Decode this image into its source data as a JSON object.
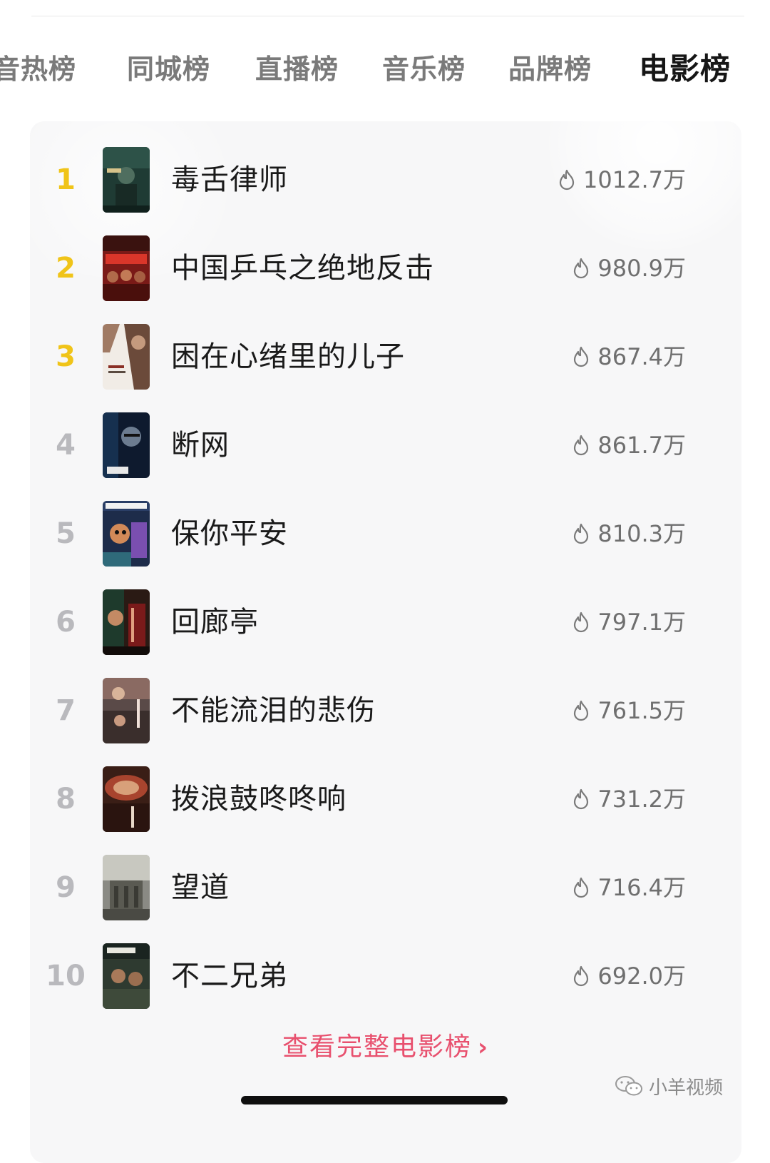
{
  "tabs": [
    {
      "label": "音热榜",
      "active": false
    },
    {
      "label": "同城榜",
      "active": false
    },
    {
      "label": "直播榜",
      "active": false
    },
    {
      "label": "音乐榜",
      "active": false
    },
    {
      "label": "品牌榜",
      "active": false
    },
    {
      "label": "电影榜",
      "active": true
    }
  ],
  "ranking": {
    "heat_icon": "flame-icon",
    "items": [
      {
        "rank": "1",
        "title": "毒舌律师",
        "heat": "1012.7万"
      },
      {
        "rank": "2",
        "title": "中国乒乓之绝地反击",
        "heat": "980.9万"
      },
      {
        "rank": "3",
        "title": "困在心绪里的儿子",
        "heat": "867.4万"
      },
      {
        "rank": "4",
        "title": "断网",
        "heat": "861.7万"
      },
      {
        "rank": "5",
        "title": "保你平安",
        "heat": "810.3万"
      },
      {
        "rank": "6",
        "title": "回廊亭",
        "heat": "797.1万"
      },
      {
        "rank": "7",
        "title": "不能流泪的悲伤",
        "heat": "761.5万"
      },
      {
        "rank": "8",
        "title": "拨浪鼓咚咚响",
        "heat": "731.2万"
      },
      {
        "rank": "9",
        "title": "望道",
        "heat": "716.4万"
      },
      {
        "rank": "10",
        "title": "不二兄弟",
        "heat": "692.0万"
      }
    ]
  },
  "see_all": {
    "label": "查看完整电影榜",
    "icon": "chevron-right-icon"
  },
  "watermark": {
    "text": "小羊视频",
    "icon": "wechat-icon"
  },
  "colors": {
    "accent": "#e8506e",
    "top_rank": "#f0c419",
    "rank": "#b9b9bd",
    "card_bg": "#f7f7f8"
  }
}
